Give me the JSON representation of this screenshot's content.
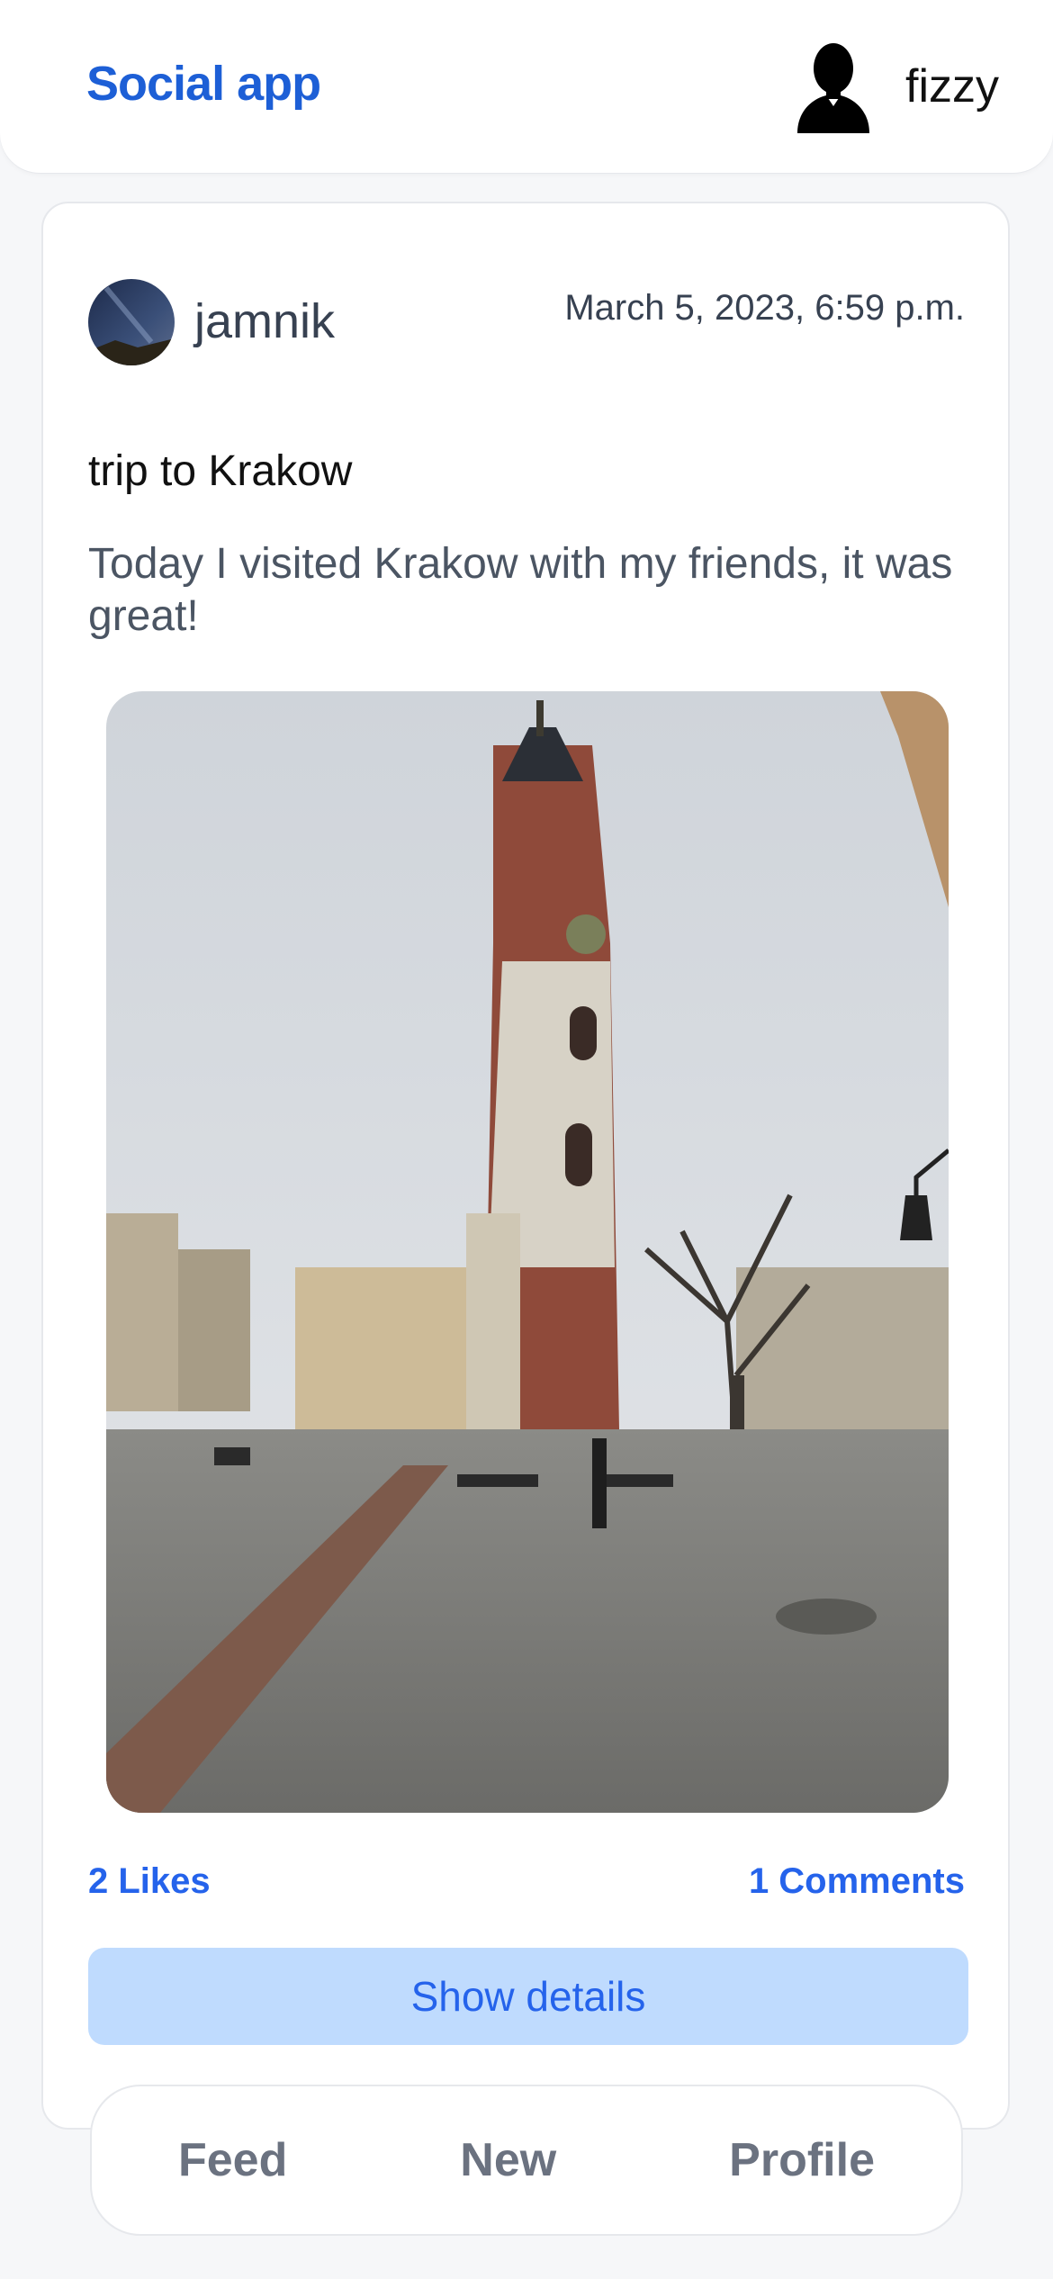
{
  "header": {
    "brand": "Social app",
    "username": "fizzy",
    "avatar_icon": "person-silhouette-icon"
  },
  "post": {
    "author": "jamnik",
    "date": "March 5, 2023, 6:59 p.m.",
    "title": "trip to Krakow",
    "body": "Today I visited Krakow with my friends, it was great!",
    "likes": "2 Likes",
    "comments": "1 Comments",
    "details_button": "Show details"
  },
  "nav": {
    "feed": "Feed",
    "new": "New",
    "profile": "Profile"
  },
  "colors": {
    "brand": "#1d5fd6",
    "link": "#2563eb",
    "button_bg": "#bfdbfe"
  }
}
